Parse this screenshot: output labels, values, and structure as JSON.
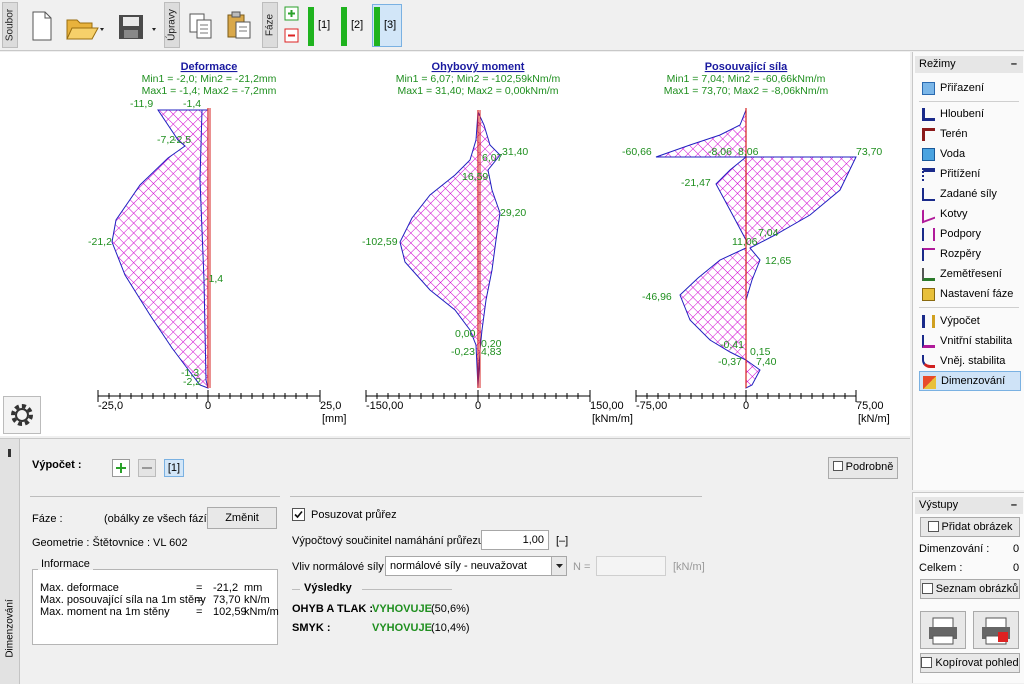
{
  "toolbar": {
    "soubor_label": "Soubor",
    "upravy_label": "Úpravy",
    "faze_label": "Fáze",
    "stages": [
      "[1]",
      "[2]",
      "[3]"
    ],
    "active_stage": "[3]"
  },
  "charts": [
    {
      "title": "Deformace",
      "line1": "Min1 = -2,0; Min2 = -21,2mm",
      "line2": "Max1 = -1,4; Max2 = -7,2mm",
      "axis_ticks": [
        "-25,0",
        "0",
        "25,0"
      ],
      "unit": "[mm]",
      "labels": [
        "-11,9",
        "-1,4",
        "-7,2",
        "-2,5",
        "-21,2",
        "-1,4",
        "-1,3",
        "-2,2"
      ]
    },
    {
      "title": "Ohybový moment",
      "line1": "Min1 = 6,07; Min2 = -102,59kNm/m",
      "line2": "Max1 = 31,40; Max2 = 0,00kNm/m",
      "axis_ticks": [
        "-150,00",
        "0",
        "150,00"
      ],
      "unit": "[kNm/m]",
      "labels": [
        "31,40",
        "6,07",
        "16,59",
        "29,20",
        "-102,59",
        "0,00",
        "0,20",
        "-0,23",
        "4,83"
      ]
    },
    {
      "title": "Posouvající síla",
      "line1": "Min1 = 7,04; Min2 = -60,66kNm/m",
      "line2": "Max1 = 73,70; Max2 = -8,06kNm/m",
      "axis_ticks": [
        "-75,00",
        "0",
        "75,00"
      ],
      "unit": "[kN/m]",
      "labels": [
        "-60,66",
        "-8,06",
        "8,06",
        "73,70",
        "-21,47",
        "7,04",
        "11,06",
        "12,65",
        "-46,96",
        "-0,41",
        "0,15",
        "-0,37",
        "7,40"
      ]
    }
  ],
  "modes": {
    "header": "Režimy",
    "items": [
      {
        "label": "Přiřazení",
        "icon": "assign-icon",
        "active": false
      },
      {
        "label": "Hloubení",
        "icon": "excavation-icon",
        "active": false
      },
      {
        "label": "Terén",
        "icon": "terrain-icon",
        "active": false
      },
      {
        "label": "Voda",
        "icon": "water-icon",
        "active": false
      },
      {
        "label": "Přitížení",
        "icon": "surcharge-icon",
        "active": false
      },
      {
        "label": "Zadané síly",
        "icon": "applied-forces-icon",
        "active": false
      },
      {
        "label": "Kotvy",
        "icon": "anchors-icon",
        "active": false
      },
      {
        "label": "Podpory",
        "icon": "supports-icon",
        "active": false
      },
      {
        "label": "Rozpěry",
        "icon": "struts-icon",
        "active": false
      },
      {
        "label": "Zemětřesení",
        "icon": "earthquake-icon",
        "active": false
      },
      {
        "label": "Nastavení fáze",
        "icon": "stage-settings-icon",
        "active": false
      },
      {
        "label": "Výpočet",
        "icon": "analysis-icon",
        "active": false
      },
      {
        "label": "Vnitřní stabilita",
        "icon": "internal-stability-icon",
        "active": false
      },
      {
        "label": "Vněj. stabilita",
        "icon": "external-stability-icon",
        "active": false
      },
      {
        "label": "Dimenzování",
        "icon": "dimensioning-icon",
        "active": true
      }
    ]
  },
  "outputs": {
    "header": "Výstupy",
    "add_image": "Přidat obrázek",
    "dim_label": "Dimenzování :",
    "dim_value": "0",
    "total_label": "Celkem :",
    "total_value": "0",
    "list_images": "Seznam obrázků",
    "copy_view": "Kopírovat pohled"
  },
  "bottom": {
    "side_tab": "Dimenzování",
    "vypocet_label": "Výpočet :",
    "analysis_tag": "[1]",
    "podrobne": "Podrobně",
    "faze_label": "Fáze :",
    "faze_value": "(obálky ze všech fází)",
    "zmenit": "Změnit",
    "geometrie": "Geometrie : Štětovnice : VL 602",
    "informace": "Informace",
    "info_rows": [
      {
        "label": "Max. deformace",
        "eq": "=",
        "value": "-21,2",
        "unit": "mm"
      },
      {
        "label": "Max. posouvající síla na 1m stěny",
        "eq": "=",
        "value": "73,70",
        "unit": "kN/m"
      },
      {
        "label": "Max. moment na 1m stěny",
        "eq": "=",
        "value": "102,59",
        "unit": "kNm/m"
      }
    ],
    "posuzovat": "Posuzovat průřez",
    "koef_label": "Výpočtový součinitel namáhání průřezu :",
    "koef_value": "1,00",
    "koef_unit": "[–]",
    "vliv_label": "Vliv normálové síly :",
    "vliv_value": "normálové síly - neuvažovat",
    "n_label": "N =",
    "n_unit": "[kN/m]",
    "vysledky": "Výsledky",
    "results": [
      {
        "label": "OHYB A TLAK :",
        "status": "VYHOVUJE",
        "pct": "(50,6%)"
      },
      {
        "label": "SMYK :",
        "status": "VYHOVUJE",
        "pct": "(10,4%)"
      }
    ]
  }
}
